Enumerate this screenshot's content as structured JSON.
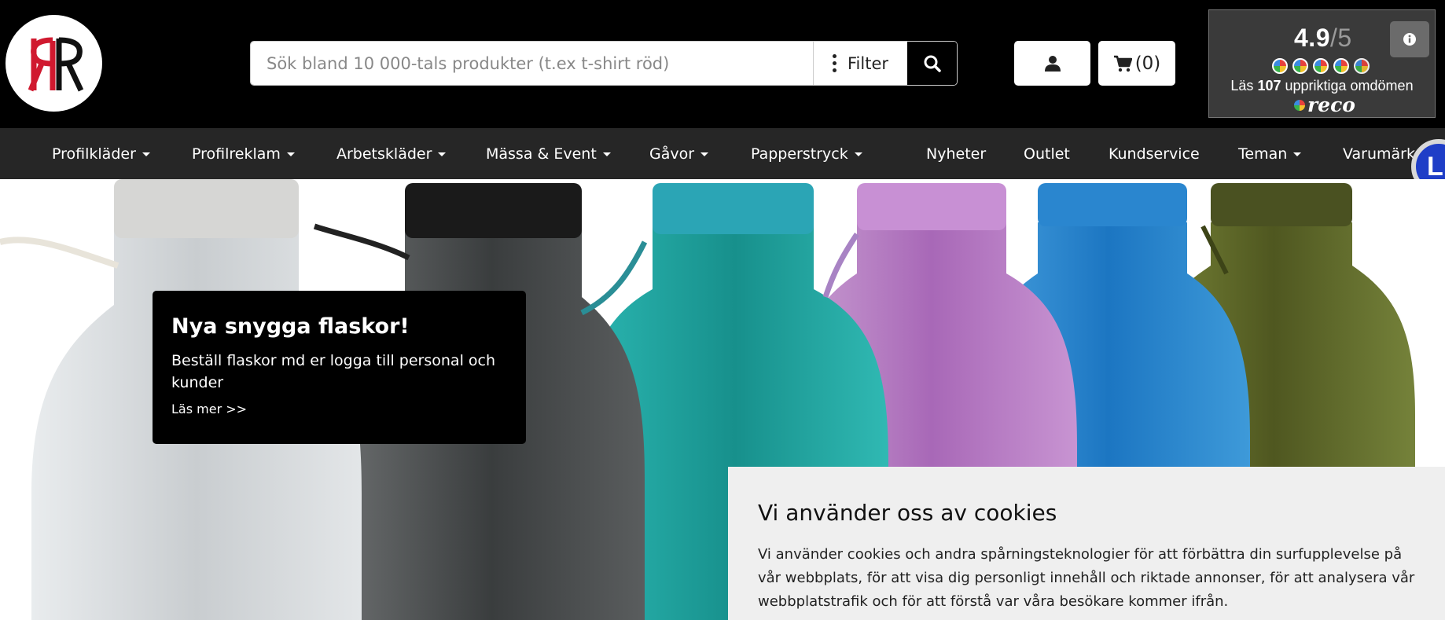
{
  "header": {
    "logo_text": "RR",
    "search": {
      "placeholder": "Sök bland 10 000-tals produkter (t.ex t-shirt röd)",
      "value": ""
    },
    "filter_label": "Filter",
    "cart_label": "(0)"
  },
  "reco": {
    "score": "4.9",
    "max": "/5",
    "text_prefix": "Läs ",
    "count": "107",
    "text_suffix": " uppriktiga omdömen",
    "brand": "reco"
  },
  "nav": {
    "items": [
      {
        "label": "Profilkläder",
        "dropdown": true
      },
      {
        "label": "Profilreklam",
        "dropdown": true
      },
      {
        "label": "Arbetskläder",
        "dropdown": true
      },
      {
        "label": "Mässa & Event",
        "dropdown": true
      },
      {
        "label": "Gåvor",
        "dropdown": true
      },
      {
        "label": "Papperstryck",
        "dropdown": true
      },
      {
        "label": "Nyheter",
        "dropdown": false
      },
      {
        "label": "Outlet",
        "dropdown": false
      },
      {
        "label": "Kundservice",
        "dropdown": false
      },
      {
        "label": "Teman",
        "dropdown": true
      },
      {
        "label": "Varumärken",
        "dropdown": false
      }
    ],
    "side_badge": "L"
  },
  "promo": {
    "title": "Nya snygga flaskor!",
    "text": "Beställ flaskor md er logga till personal och kunder",
    "link": "Läs mer >>"
  },
  "cookie": {
    "title": "Vi använder oss av cookies",
    "text": "Vi använder cookies och andra spårningsteknologier för att förbättra din surfupplevelse på vår webbplats, för att visa dig personligt innehåll och riktade annonser, för att analysera vår webbplatstrafik och för att förstå var våra besökare kommer ifrån."
  },
  "colors": {
    "header_bg": "#000000",
    "nav_bg": "#262626",
    "logo_red": "#d0192f",
    "cookie_bg": "#efefef",
    "bottle_colors": [
      "#cfd3d6",
      "#3a3d3e",
      "#1fa8a3",
      "#b577c2",
      "#2a86cf",
      "#5b6424"
    ]
  },
  "icons": [
    "user-icon",
    "cart-icon",
    "search-icon",
    "info-icon",
    "kebab-icon",
    "caret-down-icon"
  ]
}
